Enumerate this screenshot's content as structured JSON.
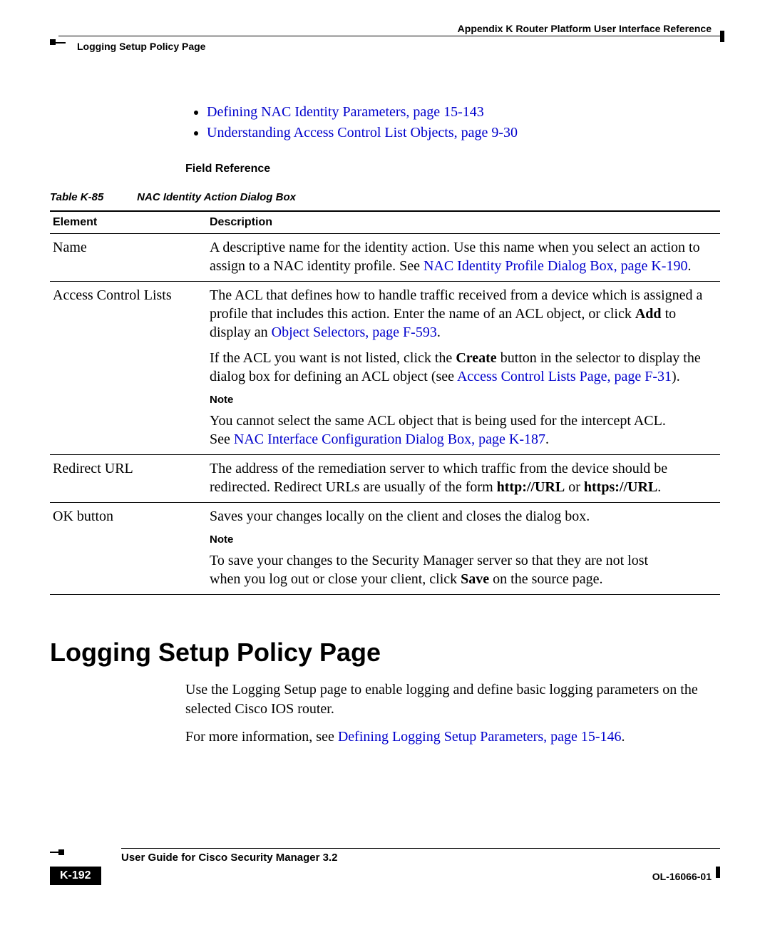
{
  "header": {
    "appendix": "Appendix K      Router Platform User Interface Reference",
    "section_running": "Logging Setup Policy Page"
  },
  "bullets": {
    "b1": "Defining NAC Identity Parameters, page 15-143",
    "b2": "Understanding Access Control List Objects, page 9-30"
  },
  "field_ref": "Field Reference",
  "table": {
    "number": "Table K-85",
    "title": "NAC Identity Action Dialog Box",
    "head_element": "Element",
    "head_desc": "Description",
    "rows": {
      "name": {
        "element": "Name",
        "desc_pre": "A descriptive name for the identity action. Use this name when you select an action to assign to a NAC identity profile. See ",
        "desc_link": "NAC Identity Profile Dialog Box, page K-190",
        "desc_post": "."
      },
      "acl": {
        "element": "Access Control Lists",
        "p1_pre": "The ACL that defines how to handle traffic received from a device which is assigned a profile that includes this action. Enter the name of an ACL object, or click ",
        "p1_bold": "Add",
        "p1_mid": " to display an ",
        "p1_link": "Object Selectors, page F-593",
        "p1_post": ".",
        "p2_pre": "If the ACL you want is not listed, click the ",
        "p2_bold": "Create",
        "p2_mid": " button in the selector to display the dialog box for defining an ACL object (see ",
        "p2_link": "Access Control Lists Page, page F-31",
        "p2_post": ").",
        "note_label": "Note",
        "note_pre": "You cannot select the same ACL object that is being used for the intercept ACL. See ",
        "note_link": "NAC Interface Configuration Dialog Box, page K-187",
        "note_post": "."
      },
      "redirect": {
        "element": "Redirect URL",
        "pre": "The address of the remediation server to which traffic from the device should be redirected. Redirect URLs are usually of the form ",
        "b1": "http://URL",
        "mid": " or ",
        "b2": "https://URL",
        "post": "."
      },
      "ok": {
        "element": "OK button",
        "p1": "Saves your changes locally on the client and closes the dialog box.",
        "note_label": "Note",
        "note_pre": "To save your changes to the Security Manager server so that they are not lost when you log out or close your client, click ",
        "note_bold": "Save",
        "note_post": " on the source page."
      }
    }
  },
  "section_heading": "Logging Setup Policy Page",
  "body": {
    "p1": "Use the Logging Setup page to enable logging and define basic logging parameters on the selected Cisco IOS router.",
    "p2_pre": "For more information, see ",
    "p2_link": "Defining Logging Setup Parameters, page 15-146",
    "p2_post": "."
  },
  "footer": {
    "guide": "User Guide for Cisco Security Manager 3.2",
    "page": "K-192",
    "docid": "OL-16066-01"
  }
}
